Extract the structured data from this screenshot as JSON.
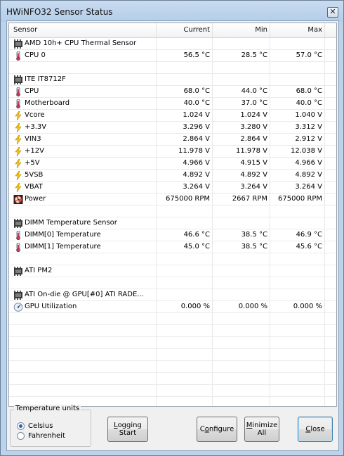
{
  "window": {
    "title": "HWiNFO32 Sensor Status",
    "close_glyph": "✕"
  },
  "columns": [
    "Sensor",
    "Current",
    "Min",
    "Max"
  ],
  "rows": [
    {
      "type": "group",
      "icon": "chip-icon",
      "name": "AMD 10h+ CPU Thermal Sensor",
      "current": "",
      "min": "",
      "max": ""
    },
    {
      "type": "item",
      "icon": "thermometer-icon",
      "name": "CPU 0",
      "current": "56.5 °C",
      "min": "28.5 °C",
      "max": "57.0 °C"
    },
    {
      "type": "blank",
      "icon": "",
      "name": "",
      "current": "",
      "min": "",
      "max": ""
    },
    {
      "type": "group",
      "icon": "chip-icon",
      "name": "ITE IT8712F",
      "current": "",
      "min": "",
      "max": ""
    },
    {
      "type": "item",
      "icon": "thermometer-icon",
      "name": "CPU",
      "current": "68.0 °C",
      "min": "44.0 °C",
      "max": "68.0 °C"
    },
    {
      "type": "item",
      "icon": "thermometer-icon",
      "name": "Motherboard",
      "current": "40.0 °C",
      "min": "37.0 °C",
      "max": "40.0 °C"
    },
    {
      "type": "item",
      "icon": "lightning-icon",
      "name": "Vcore",
      "current": "1.024 V",
      "min": "1.024 V",
      "max": "1.040 V"
    },
    {
      "type": "item",
      "icon": "lightning-icon",
      "name": "+3.3V",
      "current": "3.296 V",
      "min": "3.280 V",
      "max": "3.312 V"
    },
    {
      "type": "item",
      "icon": "lightning-icon",
      "name": "VIN3",
      "current": "2.864 V",
      "min": "2.864 V",
      "max": "2.912 V"
    },
    {
      "type": "item",
      "icon": "lightning-icon",
      "name": "+12V",
      "current": "11.978 V",
      "min": "11.978 V",
      "max": "12.038 V"
    },
    {
      "type": "item",
      "icon": "lightning-icon",
      "name": "+5V",
      "current": "4.966 V",
      "min": "4.915 V",
      "max": "4.966 V"
    },
    {
      "type": "item",
      "icon": "lightning-icon",
      "name": "5VSB",
      "current": "4.892 V",
      "min": "4.892 V",
      "max": "4.892 V"
    },
    {
      "type": "item",
      "icon": "lightning-icon",
      "name": "VBAT",
      "current": "3.264 V",
      "min": "3.264 V",
      "max": "3.264 V"
    },
    {
      "type": "item",
      "icon": "fan-icon",
      "name": "Power",
      "current": "675000 RPM",
      "min": "2667 RPM",
      "max": "675000 RPM"
    },
    {
      "type": "blank",
      "icon": "",
      "name": "",
      "current": "",
      "min": "",
      "max": ""
    },
    {
      "type": "group",
      "icon": "chip-icon",
      "name": "DIMM Temperature Sensor",
      "current": "",
      "min": "",
      "max": ""
    },
    {
      "type": "item",
      "icon": "thermometer-icon",
      "name": "DIMM[0] Temperature",
      "current": "46.6 °C",
      "min": "38.5 °C",
      "max": "46.9 °C"
    },
    {
      "type": "item",
      "icon": "thermometer-icon",
      "name": "DIMM[1] Temperature",
      "current": "45.0 °C",
      "min": "38.5 °C",
      "max": "45.6 °C"
    },
    {
      "type": "blank",
      "icon": "",
      "name": "",
      "current": "",
      "min": "",
      "max": ""
    },
    {
      "type": "group",
      "icon": "chip-icon",
      "name": "ATI PM2",
      "current": "",
      "min": "",
      "max": ""
    },
    {
      "type": "blank",
      "icon": "",
      "name": "",
      "current": "",
      "min": "",
      "max": ""
    },
    {
      "type": "group",
      "icon": "chip-icon",
      "name": "ATI On-die @ GPU[#0] ATI RADE...",
      "current": "",
      "min": "",
      "max": ""
    },
    {
      "type": "item",
      "icon": "gauge-icon",
      "name": "GPU Utilization",
      "current": "0.000 %",
      "min": "0.000 %",
      "max": "0.000 %"
    }
  ],
  "empty_rows": 8,
  "temperature_units": {
    "label": "Temperature units",
    "options": [
      {
        "label": "Celsius",
        "selected": true
      },
      {
        "label": "Fahrenheit",
        "selected": false
      }
    ]
  },
  "buttons": {
    "logging_line1": "Logging",
    "logging_line2": "Start",
    "configure": "Configure",
    "minimize_line1": "Minimize",
    "minimize_line2": "All",
    "close": "Close"
  }
}
